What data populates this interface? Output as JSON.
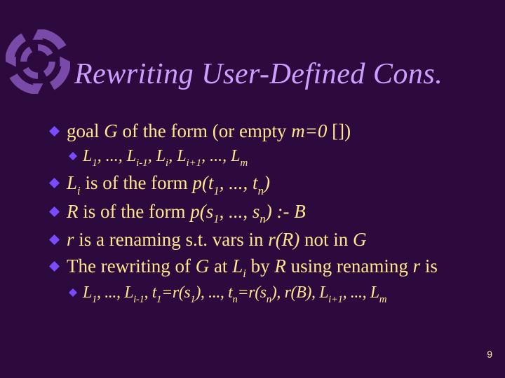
{
  "title": "Rewriting User-Defined Cons.",
  "bullets": {
    "b1": {
      "pre": "goal ",
      "G": "G",
      "mid": " of the form (or empty ",
      "m0": "m=0",
      "post": " [])"
    },
    "b1a": {
      "L1": "L",
      "s1": "1",
      "c1": ", ..., ",
      "Li1": "L",
      "si1": "i-1",
      "c2": ", ",
      "Li": "L",
      "si": "i",
      "c3": ", ",
      "Lip": "L",
      "sip": "i+1",
      "c4": ", ..., ",
      "Lm": "L",
      "sm": "m"
    },
    "b2": {
      "Li": "L",
      "si": "i",
      "mid": " is of the form ",
      "p": "p(t",
      "s1": "1",
      "c": ", ..., t",
      "sn": "n",
      "end": ")"
    },
    "b3": {
      "R": "R",
      "mid": " is of the form ",
      "p": "p(s",
      "s1": "1",
      "c": ", ..., s",
      "sn": "n",
      "end": ") :- B"
    },
    "b4": {
      "r": "r",
      "mid": " is a renaming s.t. vars in ",
      "rR": "r(R)",
      "not": " not in ",
      "G": "G"
    },
    "b5": {
      "pre": "The rewriting of ",
      "G": "G",
      "at": " at ",
      "Li": "L",
      "si": "i",
      "by": " by ",
      "R": "R",
      "using": " using renaming ",
      "r": "r",
      "is": " is"
    },
    "b5a": {
      "L1": "L",
      "s1": "1",
      "c1": ", ..., ",
      "Li1": "L",
      "si1": "i-1",
      "c2": ", ",
      "t1": "t",
      "st1": "1",
      "eq1": "=r(s",
      "ss1": "1",
      "p1": "), ..., ",
      "tn": "t",
      "stn": "n",
      "eqn": "=r(s",
      "ssn": "n",
      "pn": "), r(B), ",
      "Lip": "L",
      "sip": "i+1",
      "c3": ", ..., ",
      "Lm": "L",
      "sm": "m"
    }
  },
  "pagenum": "9"
}
